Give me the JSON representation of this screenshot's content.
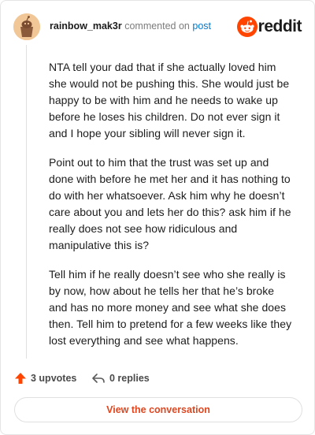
{
  "header": {
    "username": "rainbow_mak3r",
    "action_text": "commented on",
    "post_link": "post",
    "brand": "reddit"
  },
  "comment": {
    "paragraphs": [
      "NTA tell your dad that if she actually loved him she would not be pushing this. She would just be happy to be with him and he needs to wake up before he loses his children. Do not ever sign it and I hope your sibling will never sign it.",
      "Point out to him that the trust was set up and done with before he met her and it has nothing to do with her whatsoever. Ask him why he doesn’t care about you and lets her do this? ask him if he really does not see how ridiculous and manipulative this is?",
      "Tell him if he really doesn’t see who she really is by now, how about he tells her that he’s broke and has no more money and see what she does then. Tell him to pretend for a few weeks like they lost everything and see what happens."
    ]
  },
  "actions": {
    "upvotes": "3 upvotes",
    "replies": "0 replies"
  },
  "cta": {
    "label": "View the conversation"
  },
  "colors": {
    "brand": "#ff4500",
    "link": "#0079d3",
    "cta_text": "#e0461f"
  },
  "icons": {
    "avatar": "avatar-snoo",
    "brand": "reddit-logo-icon",
    "upvote": "upvote-arrow-icon",
    "reply": "reply-arrow-icon"
  }
}
